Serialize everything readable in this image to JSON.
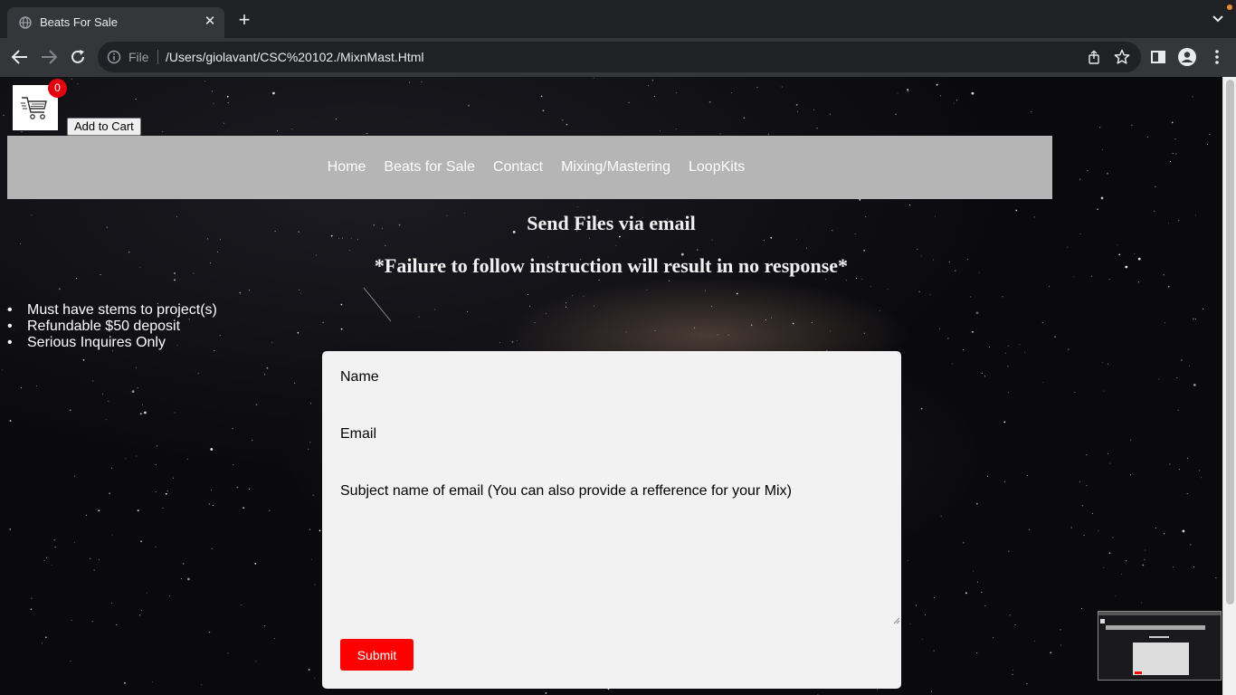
{
  "browser": {
    "tab_title": "Beats For Sale",
    "scheme_label": "File",
    "url": "/Users/giolavant/CSC%20102./MixnMast.Html"
  },
  "cart": {
    "count": "0",
    "add_to_cart_label": "Add to Cart"
  },
  "nav": {
    "items": [
      {
        "label": "Home"
      },
      {
        "label": "Beats for Sale"
      },
      {
        "label": "Contact"
      },
      {
        "label": "Mixing/Mastering"
      },
      {
        "label": "LoopKits"
      }
    ]
  },
  "page": {
    "heading": "Send Files via email",
    "warning": "*Failure to follow instruction will result in no response*",
    "requirements": [
      "Must have stems to project(s)",
      "Refundable $50 deposit",
      "Serious Inquires Only"
    ]
  },
  "form": {
    "name_label": "Name",
    "email_label": "Email",
    "subject_label": "Subject name of email (You can also provide a refference for your Mix)",
    "submit_label": "Submit"
  },
  "colors": {
    "nav_bg": "#b5b5b5",
    "submit_bg": "#ff0000",
    "badge_bg": "#e3000f",
    "form_bg": "#f2f2f2"
  }
}
